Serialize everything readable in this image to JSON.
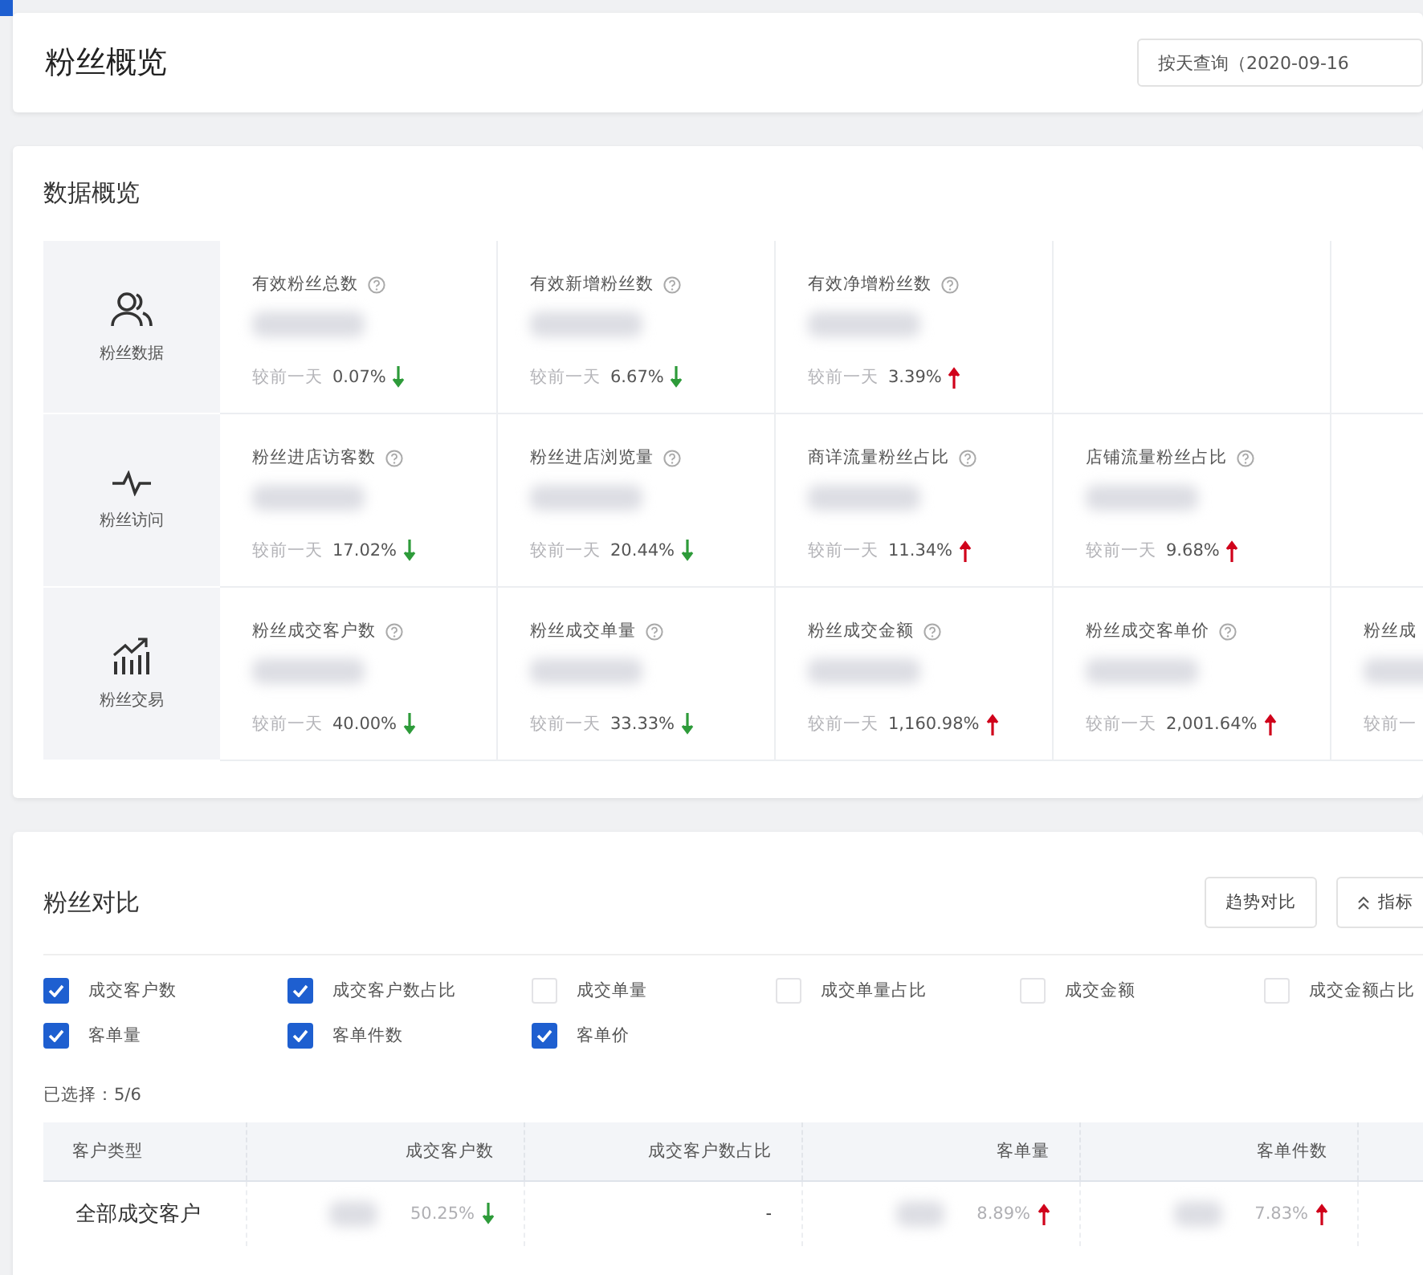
{
  "header": {
    "title": "粉丝概览",
    "date_button": "按天查询（2020-09-16"
  },
  "overview": {
    "title": "数据概览",
    "groups": [
      {
        "name": "粉丝数据",
        "metrics": [
          {
            "kind": "full",
            "label": "有效粉丝总数",
            "compare": "较前一天",
            "change": "0.07%",
            "rising": false
          },
          {
            "kind": "full",
            "label": "有效新增粉丝数",
            "compare": "较前一天",
            "change": "6.67%",
            "rising": false
          },
          {
            "kind": "full",
            "label": "有效净增粉丝数",
            "compare": "较前一天",
            "change": "3.39%",
            "rising": true
          }
        ]
      },
      {
        "name": "粉丝访问",
        "metrics": [
          {
            "kind": "full",
            "label": "粉丝进店访客数",
            "compare": "较前一天",
            "change": "17.02%",
            "rising": false
          },
          {
            "kind": "full",
            "label": "粉丝进店浏览量",
            "compare": "较前一天",
            "change": "20.44%",
            "rising": false
          },
          {
            "kind": "full",
            "label": "商详流量粉丝占比",
            "compare": "较前一天",
            "change": "11.34%",
            "rising": true
          },
          {
            "kind": "full",
            "label": "店铺流量粉丝占比",
            "compare": "较前一天",
            "change": "9.68%",
            "rising": true
          }
        ]
      },
      {
        "name": "粉丝交易",
        "metrics": [
          {
            "kind": "full",
            "label": "粉丝成交客户数",
            "compare": "较前一天",
            "change": "40.00%",
            "rising": false
          },
          {
            "kind": "full",
            "label": "粉丝成交单量",
            "compare": "较前一天",
            "change": "33.33%",
            "rising": false
          },
          {
            "kind": "full",
            "label": "粉丝成交金额",
            "compare": "较前一天",
            "change": "1,160.98%",
            "rising": true
          },
          {
            "kind": "full",
            "label": "粉丝成交客单价",
            "compare": "较前一天",
            "change": "2,001.64%",
            "rising": true
          },
          {
            "kind": "partial",
            "label": "粉丝成",
            "compare": "较前一"
          }
        ]
      }
    ]
  },
  "comparison": {
    "title": "粉丝对比",
    "buttons": [
      {
        "label": "趋势对比",
        "kind": "plain"
      },
      {
        "label": "指标",
        "kind": "collapse"
      }
    ],
    "options": [
      {
        "label": "成交客户数",
        "checked": true
      },
      {
        "label": "成交客户数占比",
        "checked": true
      },
      {
        "label": "成交单量",
        "checked": false
      },
      {
        "label": "成交单量占比",
        "checked": false
      },
      {
        "label": "成交金额",
        "checked": false
      },
      {
        "label": "成交金额占比",
        "checked": false
      },
      {
        "label": "客单量",
        "checked": true
      },
      {
        "label": "客单件数",
        "checked": true
      },
      {
        "label": "客单价",
        "checked": true
      }
    ],
    "selected_count": "已选择：5/6",
    "table": {
      "columns": [
        "客户类型",
        "成交客户数",
        "成交客户数占比",
        "客单量",
        "客单件数"
      ],
      "rows": [
        {
          "cells": [
            {
              "kind": "text",
              "text": "全部成交客户"
            },
            {
              "kind": "metric",
              "change": "50.25%",
              "rising": false
            },
            {
              "kind": "text",
              "text": "-"
            },
            {
              "kind": "metric",
              "change": "8.89%",
              "rising": true
            },
            {
              "kind": "metric",
              "change": "7.83%",
              "rising": true
            }
          ]
        }
      ]
    }
  }
}
